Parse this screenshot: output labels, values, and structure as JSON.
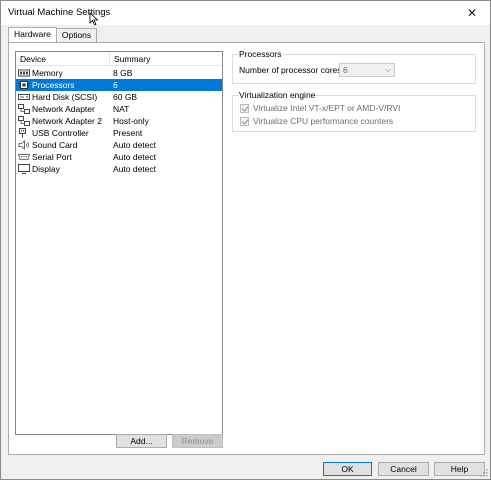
{
  "window": {
    "title": "Virtual Machine Settings",
    "close_glyph": "✕"
  },
  "tabs": [
    {
      "label": "Hardware",
      "active": true
    },
    {
      "label": "Options",
      "active": false
    }
  ],
  "device_list": {
    "headers": {
      "device": "Device",
      "summary": "Summary"
    },
    "rows": [
      {
        "device": "Memory",
        "summary": "8 GB",
        "icon": "memory-icon",
        "selected": false
      },
      {
        "device": "Processors",
        "summary": "6",
        "icon": "processor-icon",
        "selected": true
      },
      {
        "device": "Hard Disk (SCSI)",
        "summary": "60 GB",
        "icon": "hard-disk-icon",
        "selected": false
      },
      {
        "device": "Network Adapter",
        "summary": "NAT",
        "icon": "network-adapter-icon",
        "selected": false
      },
      {
        "device": "Network Adapter 2",
        "summary": "Host-only",
        "icon": "network-adapter-icon",
        "selected": false
      },
      {
        "device": "USB Controller",
        "summary": "Present",
        "icon": "usb-icon",
        "selected": false
      },
      {
        "device": "Sound Card",
        "summary": "Auto detect",
        "icon": "speaker-icon",
        "selected": false
      },
      {
        "device": "Serial Port",
        "summary": "Auto detect",
        "icon": "serial-port-icon",
        "selected": false
      },
      {
        "device": "Display",
        "summary": "Auto detect",
        "icon": "monitor-icon",
        "selected": false
      }
    ]
  },
  "list_buttons": {
    "add": "Add...",
    "remove": "Remove"
  },
  "processors_group": {
    "title": "Processors",
    "cores_label": "Number of processor cores:",
    "cores_value": "6"
  },
  "virtualization_group": {
    "title": "Virtualization engine",
    "option1": "Virtualize Intel VT-x/EPT or AMD-V/RVI",
    "option2": "Virtualize CPU performance counters"
  },
  "footer": {
    "ok": "OK",
    "cancel": "Cancel",
    "help": "Help"
  },
  "colors": {
    "selection": "#0078d7",
    "window_bg": "#f0f0f0",
    "panel_bg": "#ffffff"
  }
}
